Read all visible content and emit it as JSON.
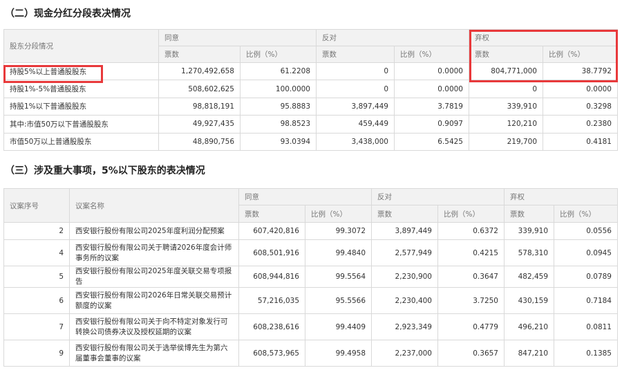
{
  "section2": {
    "title": "（二）现金分红分段表决情况",
    "header": {
      "group": "股东分段情况",
      "agree": "同意",
      "oppose": "反对",
      "abstain": "弃权",
      "votes": "票数",
      "ratio": "比例（%）"
    },
    "rows": [
      {
        "name": "持股5%以上普通股股东",
        "agree_votes": "1,270,492,658",
        "agree_ratio": "61.2208",
        "oppose_votes": "0",
        "oppose_ratio": "0.0000",
        "abstain_votes": "804,771,000",
        "abstain_ratio": "38.7792"
      },
      {
        "name": "持股1%-5%普通股股东",
        "agree_votes": "508,602,625",
        "agree_ratio": "100.0000",
        "oppose_votes": "0",
        "oppose_ratio": "0.0000",
        "abstain_votes": "0",
        "abstain_ratio": "0.0000"
      },
      {
        "name": "持股1%以下普通股股东",
        "agree_votes": "98,818,191",
        "agree_ratio": "95.8883",
        "oppose_votes": "3,897,449",
        "oppose_ratio": "3.7819",
        "abstain_votes": "339,910",
        "abstain_ratio": "0.3298"
      },
      {
        "name": "其中:市值50万以下普通股股东",
        "agree_votes": "49,927,435",
        "agree_ratio": "98.8523",
        "oppose_votes": "459,449",
        "oppose_ratio": "0.9097",
        "abstain_votes": "120,210",
        "abstain_ratio": "0.2380"
      },
      {
        "name": "市值50万以上普通股股东",
        "agree_votes": "48,890,756",
        "agree_ratio": "93.0394",
        "oppose_votes": "3,438,000",
        "oppose_ratio": "6.5425",
        "abstain_votes": "219,700",
        "abstain_ratio": "0.4181"
      }
    ]
  },
  "section3": {
    "title": "（三）涉及重大事项，5%以下股东的表决情况",
    "header": {
      "seq": "议案序号",
      "name": "议案名称",
      "agree": "同意",
      "oppose": "反对",
      "abstain": "弃权",
      "votes": "票数",
      "ratio": "比例（%）"
    },
    "rows": [
      {
        "seq": "2",
        "name": "西安银行股份有限公司2025年度利润分配预案",
        "agree_votes": "607,420,816",
        "agree_ratio": "99.3072",
        "oppose_votes": "3,897,449",
        "oppose_ratio": "0.6372",
        "abstain_votes": "339,910",
        "abstain_ratio": "0.0556"
      },
      {
        "seq": "4",
        "name": "西安银行股份有限公司关于聘请2026年度会计师事务所的议案",
        "agree_votes": "608,501,916",
        "agree_ratio": "99.4840",
        "oppose_votes": "2,577,949",
        "oppose_ratio": "0.4215",
        "abstain_votes": "578,310",
        "abstain_ratio": "0.0945"
      },
      {
        "seq": "5",
        "name": "西安银行股份有限公司2025年度关联交易专项报告",
        "agree_votes": "608,944,816",
        "agree_ratio": "99.5564",
        "oppose_votes": "2,230,900",
        "oppose_ratio": "0.3647",
        "abstain_votes": "482,459",
        "abstain_ratio": "0.0789"
      },
      {
        "seq": "6",
        "name": "西安银行股份有限公司2026年日常关联交易预计额度的议案",
        "agree_votes": "57,216,035",
        "agree_ratio": "95.5566",
        "oppose_votes": "2,230,400",
        "oppose_ratio": "3.7250",
        "abstain_votes": "430,159",
        "abstain_ratio": "0.7184"
      },
      {
        "seq": "7",
        "name": "西安银行股份有限公司关于向不特定对象发行可转换公司债券决议及授权延期的议案",
        "agree_votes": "608,238,616",
        "agree_ratio": "99.4409",
        "oppose_votes": "2,923,349",
        "oppose_ratio": "0.4779",
        "abstain_votes": "496,210",
        "abstain_ratio": "0.0811"
      },
      {
        "seq": "9",
        "name": "西安银行股份有限公司关于选举侯博先生为第六届董事会董事的议案",
        "agree_votes": "608,573,965",
        "agree_ratio": "99.4958",
        "oppose_votes": "2,237,000",
        "oppose_ratio": "0.3657",
        "abstain_votes": "847,210",
        "abstain_ratio": "0.1385"
      }
    ]
  },
  "highlight_color": "#e8393b"
}
